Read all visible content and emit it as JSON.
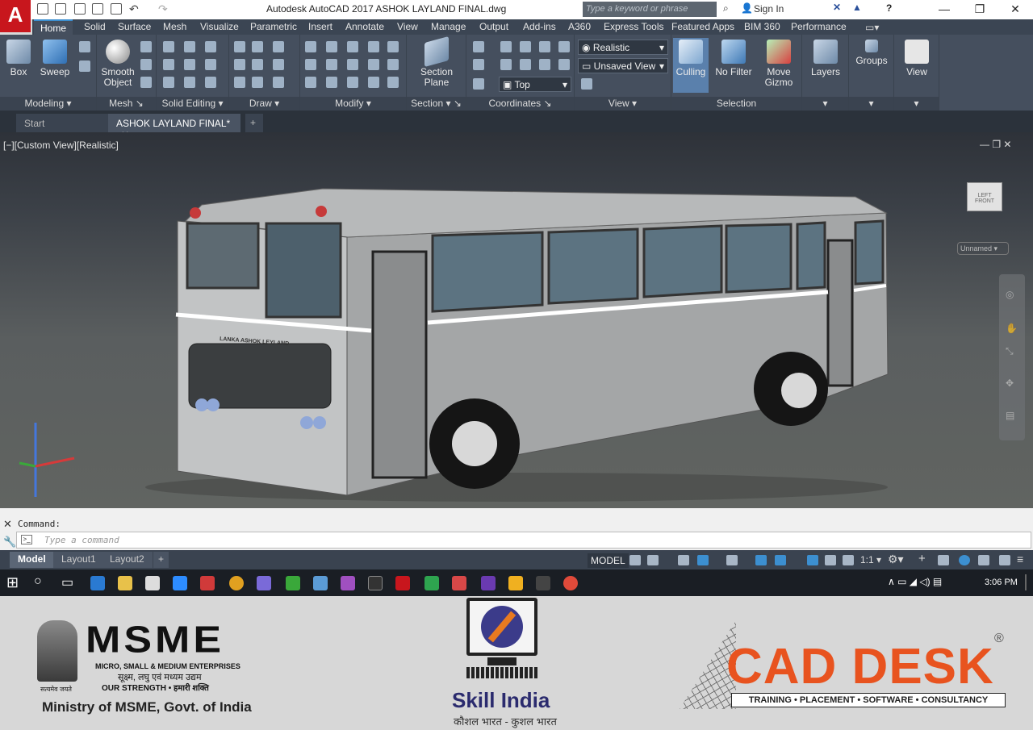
{
  "app": {
    "logo_letter": "A",
    "title": "Autodesk AutoCAD 2017    ASHOK LAYLAND FINAL.dwg",
    "search_placeholder": "Type a keyword or phrase",
    "sign_in": "Sign In",
    "help": "?"
  },
  "ribbon_tabs": [
    "Home",
    "Solid",
    "Surface",
    "Mesh",
    "Visualize",
    "Parametric",
    "Insert",
    "Annotate",
    "View",
    "Manage",
    "Output",
    "Add-ins",
    "A360",
    "Express Tools",
    "Featured Apps",
    "BIM 360",
    "Performance"
  ],
  "active_tab": "Home",
  "panels": {
    "modeling": {
      "label": "Modeling",
      "box": "Box",
      "sweep": "Sweep"
    },
    "mesh": {
      "label": "Mesh",
      "smooth_object": "Smooth Object"
    },
    "solid_editing": {
      "label": "Solid Editing"
    },
    "draw": {
      "label": "Draw"
    },
    "modify": {
      "label": "Modify"
    },
    "section": {
      "label": "Section",
      "section_plane": "Section Plane"
    },
    "coordinates": {
      "label": "Coordinates"
    },
    "view": {
      "label": "View",
      "visual_style": "Realistic",
      "named_view": "Unsaved View",
      "view_dir": "Top"
    },
    "selection": {
      "label": "Selection",
      "culling": "Culling",
      "no_filter": "No Filter",
      "move_gizmo": "Move Gizmo"
    },
    "layers": {
      "label": "Layers"
    },
    "groups": {
      "label": "Groups"
    },
    "view2": {
      "label": "View"
    }
  },
  "doc_tabs": [
    "Start",
    "ASHOK LAYLAND FINAL*"
  ],
  "viewport": {
    "label": "[−][Custom View][Realistic]",
    "bus_brand": "LANKA ASHOK LEYLAND",
    "viewcube_left": "LEFT",
    "viewcube_front": "FRONT",
    "ucs": "Unnamed"
  },
  "command": {
    "history": "Command:",
    "placeholder": "Type a command"
  },
  "layout_tabs": [
    "Model",
    "Layout1",
    "Layout2"
  ],
  "status": {
    "model": "MODEL",
    "scale": "1:1"
  },
  "taskbar": {
    "time": "3:06 PM"
  },
  "banner": {
    "msme_logo": "MSME",
    "msme_sub1": "MICRO, SMALL & MEDIUM ENTERPRISES",
    "msme_sub2": "सूक्ष्म, लघु एवं मध्यम उद्यम",
    "msme_sub3": "OUR STRENGTH • हमारी शक्ति",
    "emblem_motto": "सत्यमेव जयते",
    "ministry": "Ministry of MSME, Govt. of India",
    "skill": "Skill India",
    "skill_hindi": "कौशल भारत - कुशल भारत",
    "cad_desk": "CAD DESK",
    "cad_tagline": "TRAINING • PLACEMENT • SOFTWARE • CONSULTANCY",
    "registered": "®"
  }
}
